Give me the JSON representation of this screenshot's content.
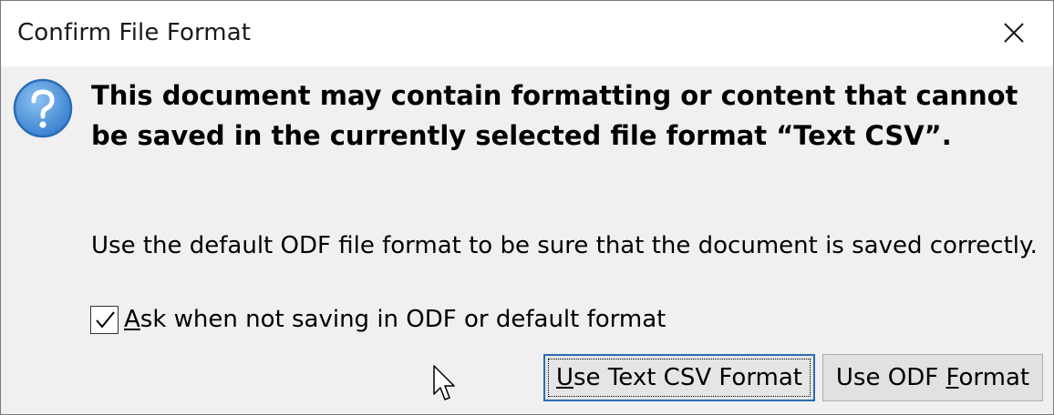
{
  "dialog": {
    "title": "Confirm File Format",
    "close_icon": "close-icon"
  },
  "message": {
    "icon": "question-icon",
    "icon_color": "#4a90d9",
    "heading": "This document may contain formatting or content that cannot be saved in the currently selected file format “Text CSV”.",
    "body": "Use the default ODF file format to be sure that the document is saved correctly."
  },
  "checkbox": {
    "checked": true,
    "label_accel": "A",
    "label_rest": "sk when not saving in ODF or default format"
  },
  "buttons": {
    "keep": {
      "accel": "U",
      "rest": "se Text CSV Format"
    },
    "odf": {
      "pre": "Use ODF ",
      "accel": "F",
      "rest": "ormat"
    }
  },
  "colors": {
    "title_bg": "#ffffff",
    "dialog_bg": "#f0f0f0",
    "focus_border": "#2b6cb0"
  }
}
